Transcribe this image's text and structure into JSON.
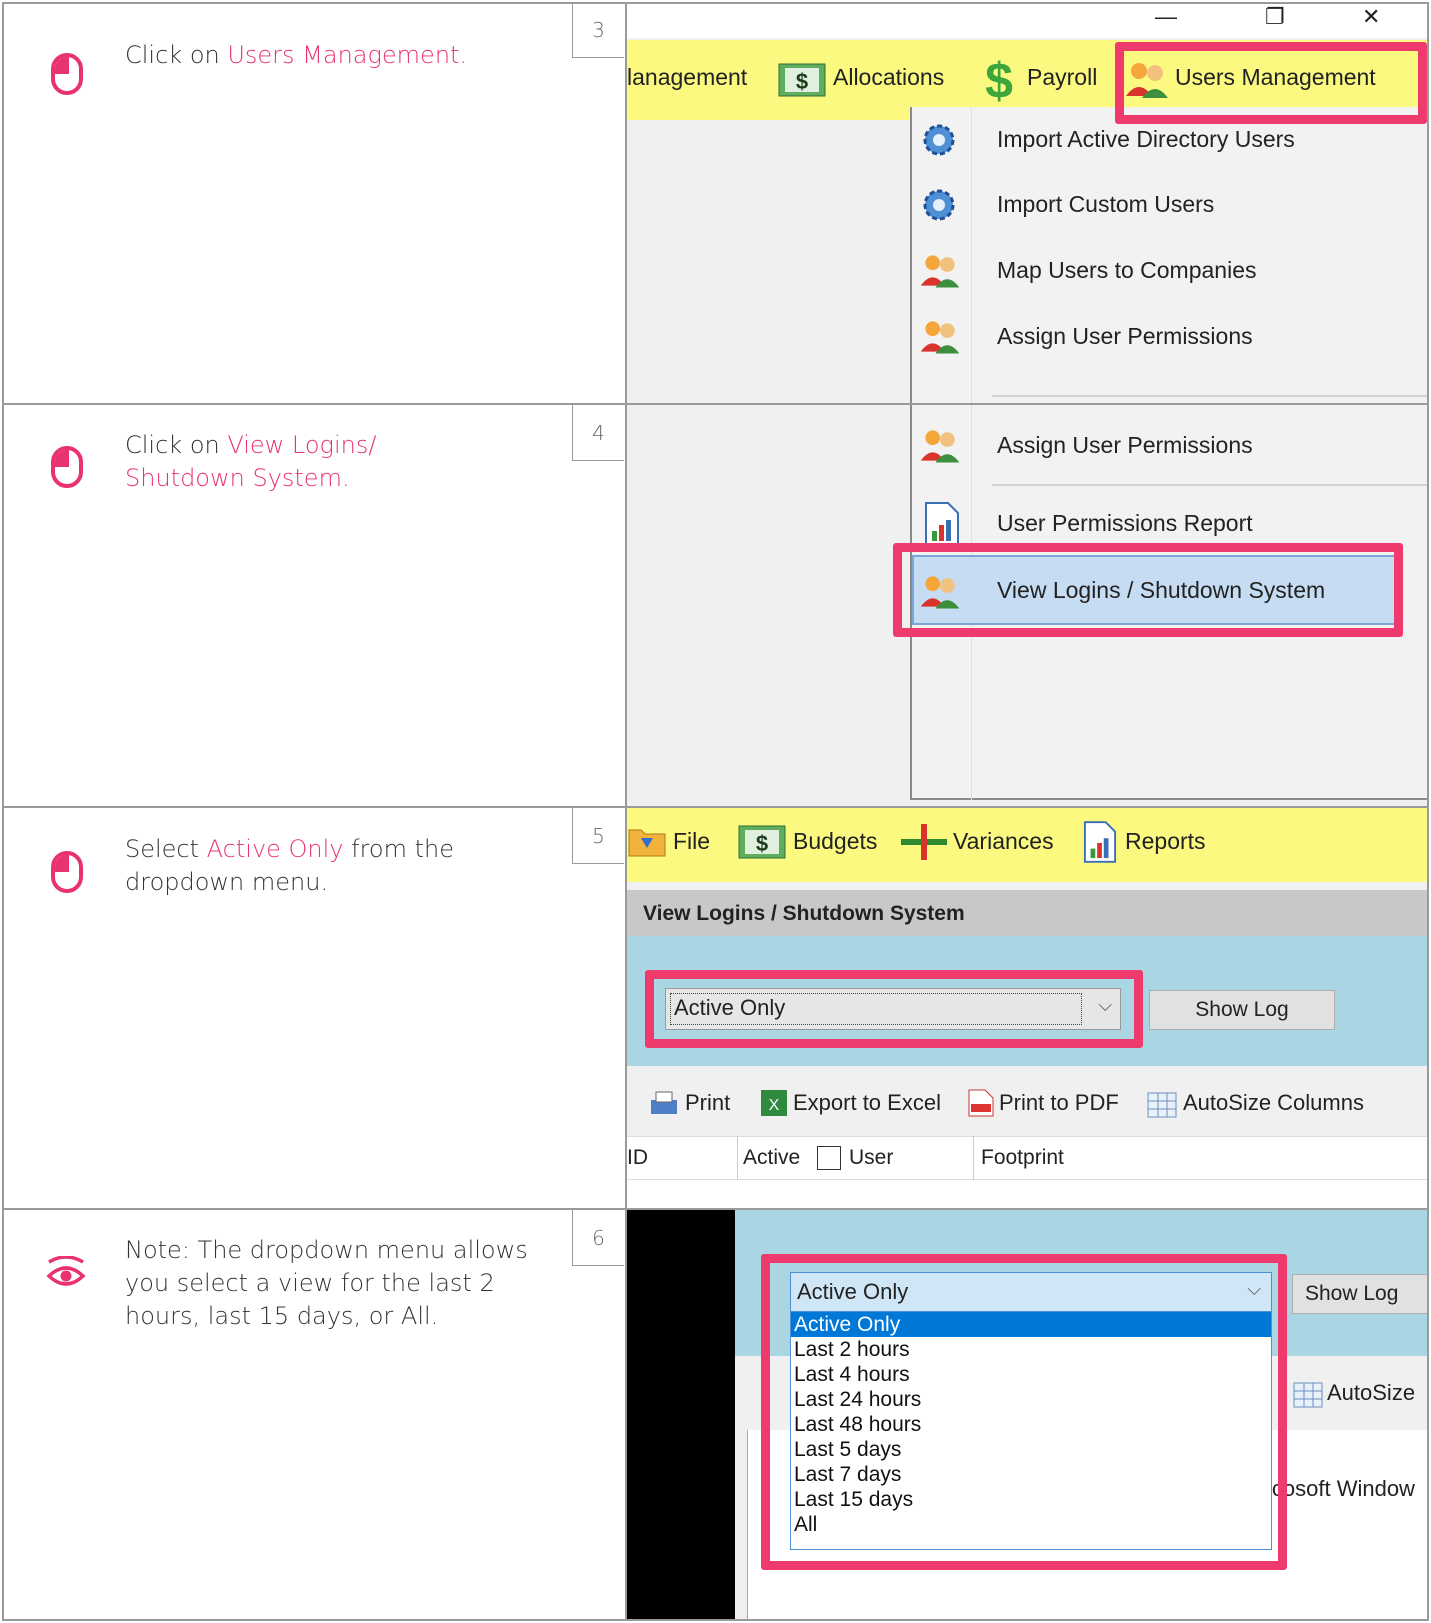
{
  "steps": [
    {
      "number": "3",
      "icon": "mouse-icon",
      "text_prefix": "Click on ",
      "text_highlight": "Users Management.",
      "text_suffix": "",
      "screenshot": {
        "window_controls": [
          "—",
          "❐",
          "✕"
        ],
        "toolbar": [
          "lanagement",
          "Allocations",
          "Payroll",
          "Users Management"
        ],
        "menu": [
          "Import Active Directory Users",
          "Import Custom Users",
          "Map Users to Companies",
          "Assign User Permissions"
        ]
      }
    },
    {
      "number": "4",
      "icon": "mouse-icon",
      "text_prefix": "Click on ",
      "text_highlight": "View Logins/ Shutdown System.",
      "text_suffix": "",
      "screenshot": {
        "menu": [
          "Assign User Permissions",
          "User Permissions Report",
          "View Logins / Shutdown System"
        ]
      }
    },
    {
      "number": "5",
      "icon": "mouse-icon",
      "text_prefix": "Select ",
      "text_highlight": "Active Only",
      "text_suffix": " from the dropdown menu.",
      "screenshot": {
        "toolbar": [
          "File",
          "Budgets",
          "Variances",
          "Reports"
        ],
        "panel_title": "View Logins / Shutdown System",
        "dropdown_value": "Active Only",
        "show_log": "Show Log",
        "actions": [
          "Print",
          "Export to Excel",
          "Print to PDF",
          "AutoSize Columns"
        ],
        "columns": [
          "ID",
          "Active",
          "User",
          "Footprint"
        ]
      }
    },
    {
      "number": "6",
      "icon": "eye-icon",
      "text_full": "Note: The dropdown menu allows you select a view for the last 2 hours, last 15 days, or All.",
      "screenshot": {
        "dropdown_value": "Active Only",
        "show_log": "Show Log",
        "autosize": "AutoSize",
        "footprint_partial": "icosoft Window",
        "options": [
          "Active Only",
          "Last 2 hours",
          "Last 4 hours",
          "Last 24 hours",
          "Last 48 hours",
          "Last 5 days",
          "Last 7 days",
          "Last 15 days",
          "All"
        ]
      }
    }
  ],
  "colors": {
    "accent": "#e8336e",
    "highlight_box": "#ef3a6e",
    "toolbar_yellow": "#fbf97f",
    "panel_blue": "#aad5e3"
  }
}
